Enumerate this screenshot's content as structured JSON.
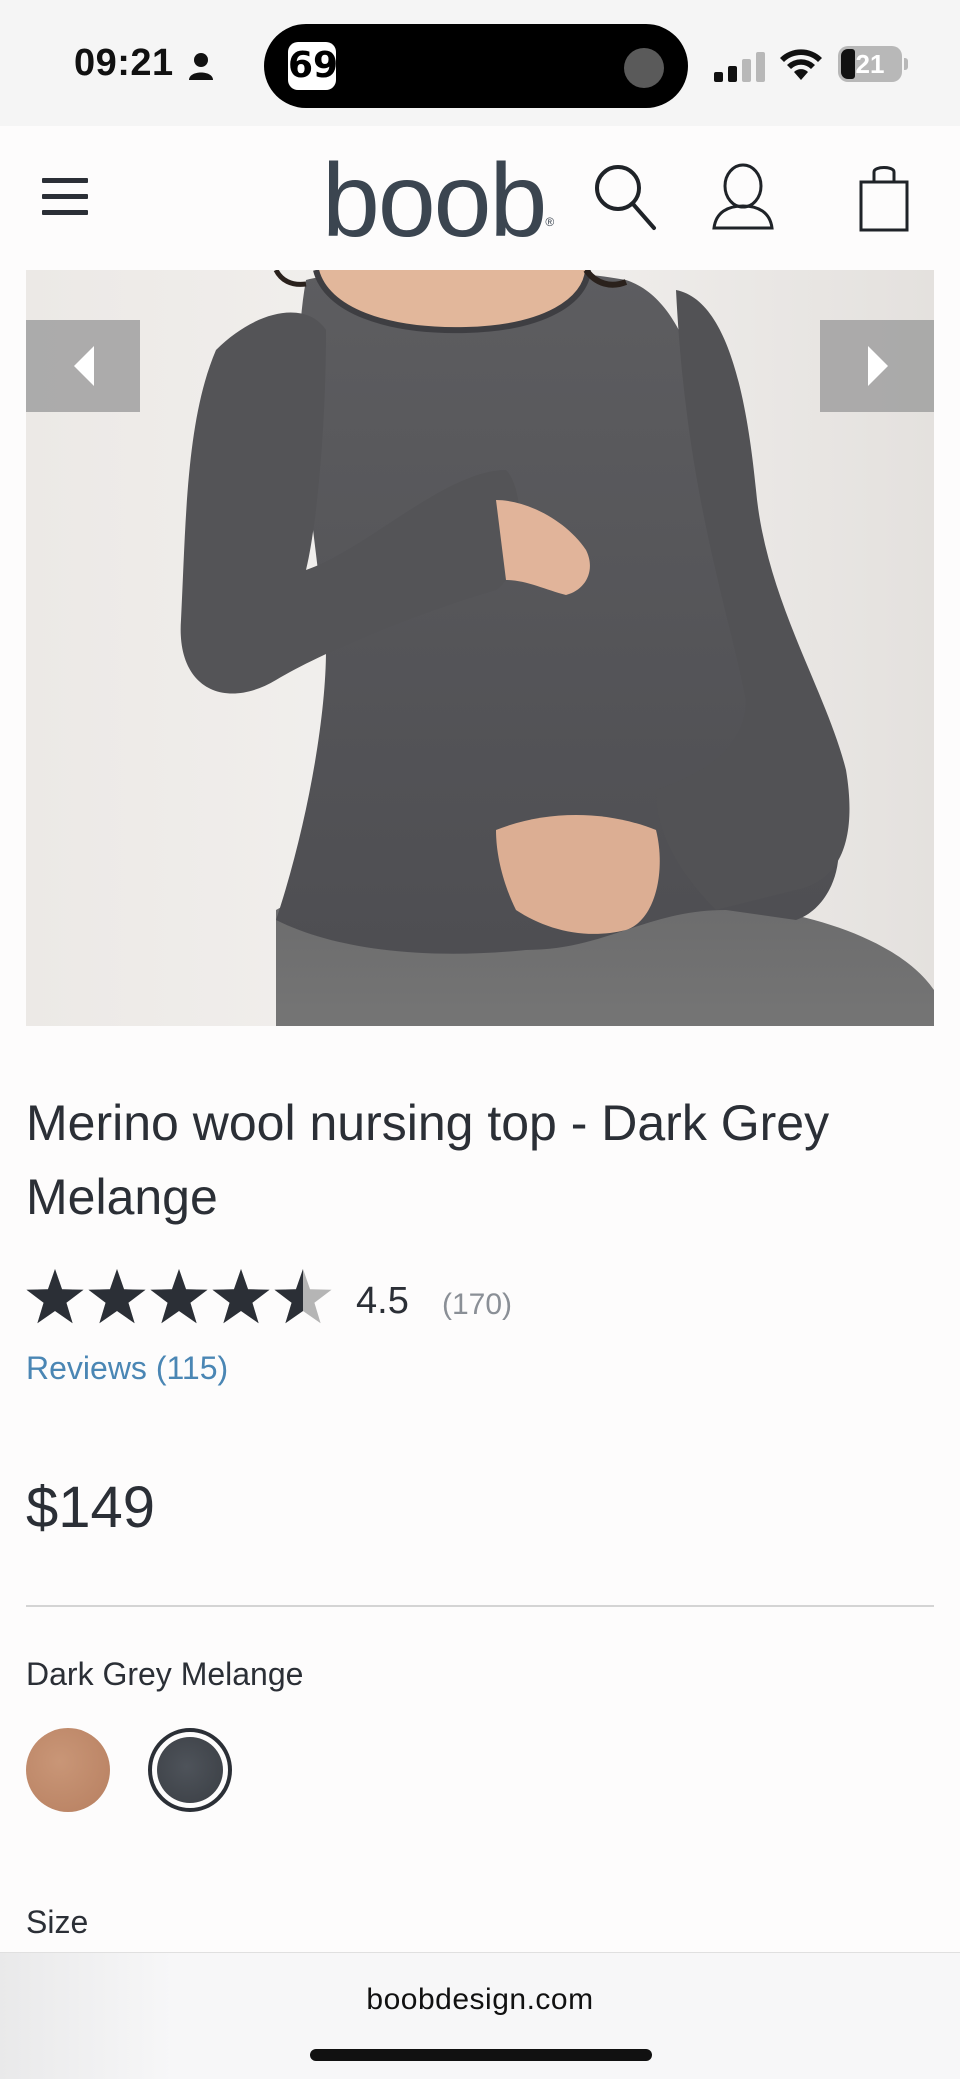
{
  "status_bar": {
    "time": "09:21",
    "app_badge": "69",
    "battery": "21"
  },
  "header": {
    "logo": "boob",
    "logo_mark": "®"
  },
  "gallery": {
    "current_image": "merino-wool-nursing-top-dark-grey-model"
  },
  "product": {
    "title": "Merino wool nursing top - Dark Grey Melange",
    "rating": "4.5",
    "rating_fraction": 0.9,
    "rating_count": "(170)",
    "reviews_link": "Reviews (115)",
    "price": "$149",
    "selected_color": "Dark Grey Melange",
    "swatches": [
      {
        "name": "nude",
        "color": "#c08a6b"
      },
      {
        "name": "dark-grey-melange",
        "color": "#43474d",
        "selected": true
      }
    ],
    "size_label": "Size"
  },
  "browser": {
    "url": "boobdesign.com"
  },
  "colors": {
    "text": "#2b2f36",
    "link": "#4a86b4",
    "star": "#2b2f36",
    "star_empty": "#b5b5b5"
  }
}
